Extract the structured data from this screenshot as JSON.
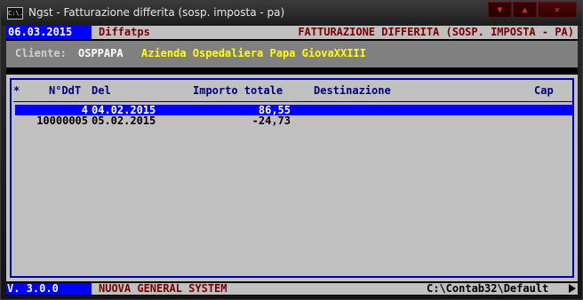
{
  "window": {
    "title": "Ngst - Fatturazione differita (sosp. imposta - pa)",
    "icon_text": "C:\\."
  },
  "top_bar": {
    "date": "06.03.2015",
    "program": "Diffatps",
    "screen_title": "FATTURAZIONE DIFFERITA (SOSP. IMPOSTA - PA)"
  },
  "client": {
    "label": "Cliente:",
    "code": "OSPPAPA",
    "name": "Azienda Ospedaliera Papa GiovaXXIII"
  },
  "list": {
    "columns": {
      "mark": "*",
      "doc_no": "N°DdT",
      "date": "Del",
      "amount": "Importo totale",
      "destination": "Destinazione",
      "cap": "Cap"
    },
    "rows": [
      {
        "doc_no": "4",
        "date": "04.02.2015",
        "amount": "86,55",
        "selected": true
      },
      {
        "doc_no": "10000005",
        "date": "05.02.2015",
        "amount": "-24,73",
        "selected": false
      }
    ]
  },
  "bottom_bar": {
    "version": "V. 3.0.0",
    "company": "NUOVA GENERAL SYSTEM",
    "path": "C:\\Contab32\\Default"
  },
  "colors": {
    "console_bg": "#c0c0c0",
    "accent_blue": "#0000ff",
    "dark_red": "#7a0000",
    "client_yellow": "#ffff00"
  }
}
